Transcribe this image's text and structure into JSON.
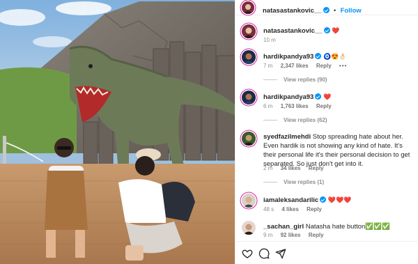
{
  "post": {
    "author": "natasastankovic__",
    "follow_label": "Follow",
    "dot": "•",
    "caption": {
      "username": "natasastankovic__",
      "text": "❤️",
      "time": "10 m"
    }
  },
  "comments": [
    {
      "username": "hardikpandya93",
      "text": "🧿😍👌🏻",
      "time": "7 m",
      "likes": "2,347 likes",
      "reply": "Reply",
      "more": "•••",
      "view_replies": "View replies (90)"
    },
    {
      "username": "hardikpandya93",
      "text": "❤️",
      "time": "6 m",
      "likes": "1,763 likes",
      "reply": "Reply",
      "view_replies": "View replies (62)"
    },
    {
      "username": "syedfazilmehdi",
      "text": "Stop spreading hate about her. Even hardik is not showing any kind of hate. It's their personal life it's their personal decision to get separated. So just don't get into it.",
      "time": "2 m",
      "likes": "34 likes",
      "reply": "Reply",
      "view_replies": "View replies (1)"
    },
    {
      "username": "iamaleksandarilic",
      "text": "❤️❤️❤️",
      "time": "48 s",
      "likes": "4 likes",
      "reply": "Reply"
    },
    {
      "username": "_sachan_girl",
      "text": "Natasha hate button✅✅✅",
      "time": "9 m",
      "likes": "92 likes",
      "reply": "Reply"
    }
  ],
  "icons": {
    "like": "heart-icon",
    "comment": "comment-icon",
    "share": "share-icon"
  },
  "colors": {
    "link_blue": "#0095f6",
    "verified_blue": "#0095f6",
    "text": "#262626",
    "meta_gray": "#8e8e8e"
  }
}
